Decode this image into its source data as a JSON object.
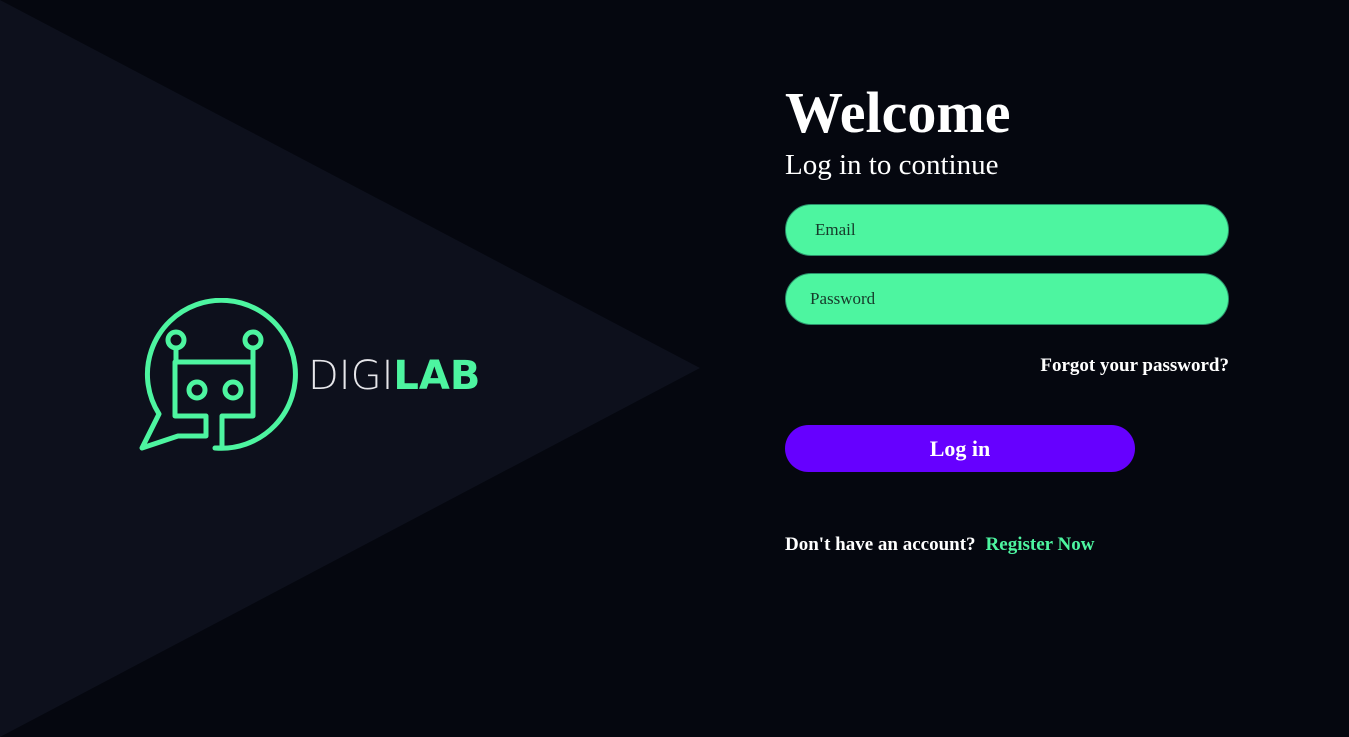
{
  "colors": {
    "background": "#05070f",
    "triangle": "#0d101c",
    "accent_green": "#4df5a0",
    "button_purple": "#6600ff",
    "text_white": "#ffffff"
  },
  "brand": {
    "logo_icon": "robot-chat-bubble-icon",
    "name_light": "DIGI",
    "name_bold": "LAB"
  },
  "heading": {
    "title": "Welcome",
    "subtitle": "Log in to continue"
  },
  "form": {
    "email_placeholder": "Email",
    "password_placeholder": "Password",
    "forgot_label": "Forgot your password?",
    "login_label": "Log in"
  },
  "register": {
    "prompt": "Don't have an account?",
    "link_label": "Register Now"
  }
}
